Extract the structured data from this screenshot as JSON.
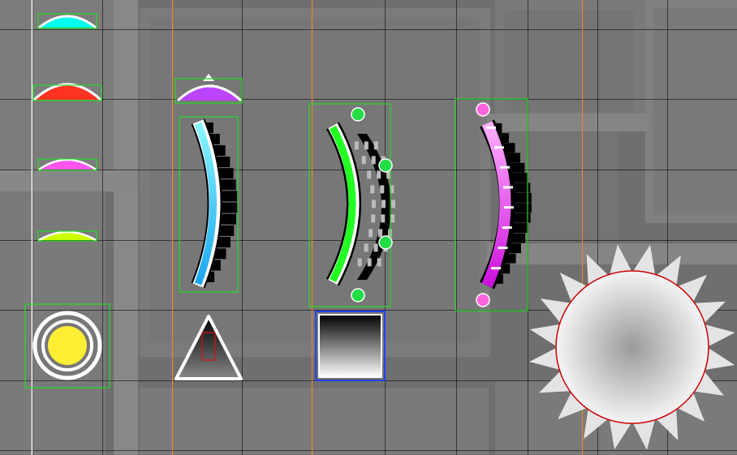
{
  "editor": {
    "view": "level-editor-canvas",
    "grid": true,
    "guide_line_colors": {
      "white": "#ffffff",
      "orange": "#e08a2a"
    },
    "selection_color": "#22dd22",
    "handle_colors": {
      "green": "#22dd44",
      "pink": "#ff66dd"
    }
  },
  "objects": {
    "bounce_pads": [
      {
        "icon": "bounce-pad-icon",
        "color": "#00ffee"
      },
      {
        "icon": "bounce-pad-icon",
        "color": "#ff3322"
      },
      {
        "icon": "bounce-pad-icon",
        "color": "#ff55ee"
      },
      {
        "icon": "bounce-pad-icon",
        "color": "#ccff00"
      }
    ],
    "spider_pad": {
      "icon": "spider-pad-icon",
      "color": "#bb44ff"
    },
    "portal_cyan": {
      "icon": "gravity-portal-icon",
      "color": "#33ccff"
    },
    "portal_green": {
      "icon": "mini-portal-icon",
      "color": "#22ff22"
    },
    "portal_magenta": {
      "icon": "dual-portal-icon",
      "color": "#ff33ff"
    },
    "jump_ring": {
      "icon": "jump-orb-icon",
      "color": "#ffee33"
    },
    "spike": {
      "icon": "spike-icon"
    },
    "block": {
      "icon": "block-icon",
      "border": "#2244ff"
    },
    "saw": {
      "icon": "sawblade-icon",
      "outline": "#cc0000"
    }
  }
}
